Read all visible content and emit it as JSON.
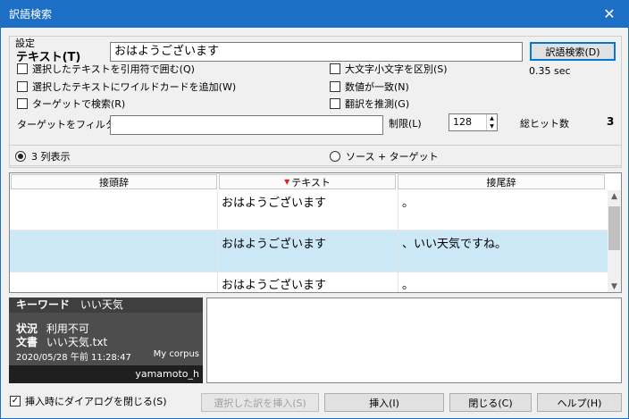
{
  "window": {
    "title": "訳語検索"
  },
  "settings": {
    "group_label": "設定",
    "text_label": "テキスト(T)",
    "text_value": "おはようございます",
    "search_button": "訳語検索(D)",
    "elapsed": "0.35 sec",
    "checkboxes": {
      "quote": "選択したテキストを引用符で囲む(Q)",
      "wildcard": "選択したテキストにワイルドカードを追加(W)",
      "target_search": "ターゲットで検索(R)",
      "case": "大文字小文字を区別(S)",
      "number": "数値が一致(N)",
      "guess": "翻訳を推測(G)"
    },
    "filter_label": "ターゲットをフィルタ",
    "filter_value": "",
    "limit_label": "制限(L)",
    "limit_value": "128",
    "hits_label": "総ヒット数",
    "hits_value": "3"
  },
  "view": {
    "three_col": "3 列表示",
    "source_target": "ソース + ターゲット"
  },
  "grid": {
    "headers": {
      "prefix": "接頭辞",
      "text": "テキスト",
      "suffix": "接尾辞"
    },
    "rows": [
      {
        "prefix": "",
        "text": "おはようございます",
        "suffix": "。"
      },
      {
        "prefix": "",
        "text": "おはようございます",
        "suffix": "、いい天気ですね。"
      },
      {
        "prefix": "",
        "text": "おはようございます",
        "suffix": "。"
      }
    ]
  },
  "info": {
    "keyword_label": "キーワード",
    "keyword_value": "いい天気",
    "status_label": "状況",
    "status_value": "利用不可",
    "doc_label": "文書",
    "doc_value": "いい天気.txt",
    "date": "2020/05/28 午前 11:28:47",
    "corpus": "My corpus",
    "user": "yamamoto_h"
  },
  "footer": {
    "close_on_insert": "挿入時にダイアログを閉じる(S)",
    "insert_selected": "選択した訳を挿入(S)",
    "insert": "挿入(I)",
    "close": "閉じる(C)",
    "help": "ヘルプ(H)"
  }
}
